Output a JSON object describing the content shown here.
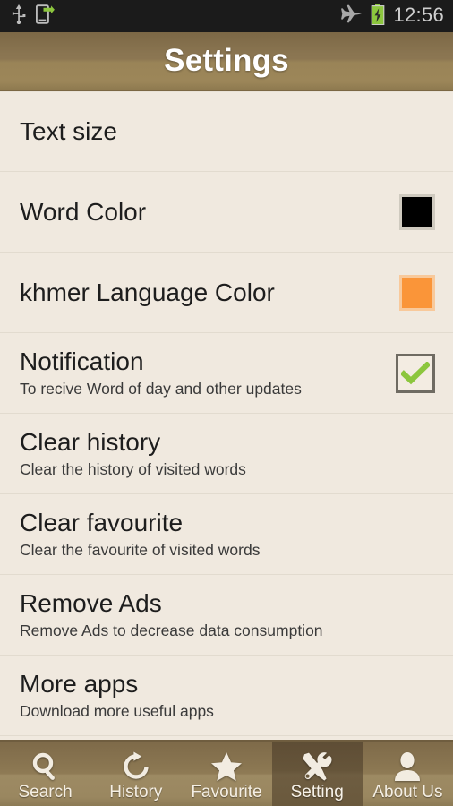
{
  "status_bar": {
    "icons_left": [
      "usb-icon",
      "usb-transfer-icon"
    ],
    "icons_right": [
      "airplane-mode-icon",
      "battery-charging-icon"
    ],
    "time": "12:56",
    "background": "#1b1b1b",
    "battery_color": "#8cc63e"
  },
  "action_bar": {
    "title": "Settings",
    "background_top": "#7c6846",
    "background_bottom": "#9c8659"
  },
  "settings": {
    "rows": [
      {
        "title": "Text size",
        "subtitle": "",
        "accessory": "none",
        "name": "text-size"
      },
      {
        "title": "Word Color",
        "subtitle": "",
        "accessory": "color-swatch",
        "color": "#000000",
        "name": "word-color"
      },
      {
        "title": "khmer Language Color",
        "subtitle": "",
        "accessory": "color-swatch",
        "color": "#fa9539",
        "name": "khmer-language-color"
      },
      {
        "title": "Notification",
        "subtitle": "To recive Word of day and other updates",
        "accessory": "checkbox",
        "checked": true,
        "check_color": "#8cc63e",
        "name": "notification"
      },
      {
        "title": "Clear history",
        "subtitle": "Clear the history of visited words",
        "accessory": "none",
        "name": "clear-history"
      },
      {
        "title": "Clear favourite",
        "subtitle": "Clear the favourite of visited words",
        "accessory": "none",
        "name": "clear-favourite"
      },
      {
        "title": "Remove Ads",
        "subtitle": "Remove Ads to decrease data consumption",
        "accessory": "none",
        "name": "remove-ads"
      },
      {
        "title": "More apps",
        "subtitle": "Download more useful apps",
        "accessory": "none",
        "name": "more-apps"
      }
    ]
  },
  "tab_bar": {
    "selected_index": 3,
    "selected_background": "#655438",
    "tabs": [
      {
        "label": "Search",
        "icon": "search-icon"
      },
      {
        "label": "History",
        "icon": "refresh-clock-icon"
      },
      {
        "label": "Favourite",
        "icon": "star-icon"
      },
      {
        "label": "Setting",
        "icon": "tools-icon"
      },
      {
        "label": "About Us",
        "icon": "person-icon"
      }
    ]
  }
}
